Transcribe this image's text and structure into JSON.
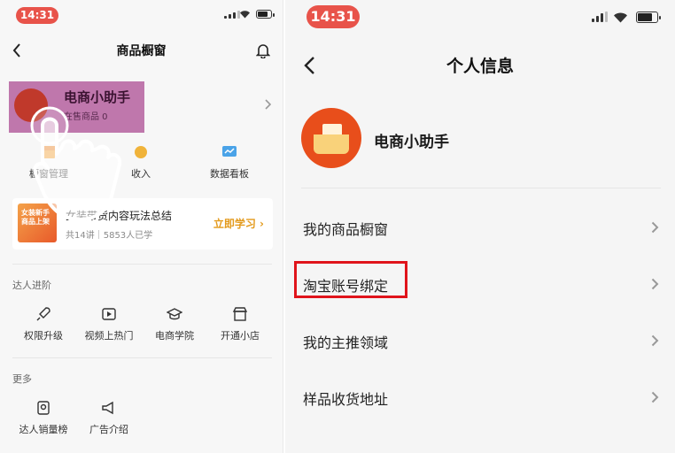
{
  "left": {
    "status": {
      "time": "14:31"
    },
    "nav": {
      "title": "商品橱窗"
    },
    "user": {
      "name": "电商小助手",
      "sub": "在售商品 0"
    },
    "tools": [
      {
        "label": "橱窗管理",
        "icon": "shop-icon"
      },
      {
        "label": "收入",
        "icon": "income-icon"
      },
      {
        "label": "数据看板",
        "icon": "chart-icon"
      }
    ],
    "course": {
      "thumb_text": "女装新手 商品上架",
      "title": "女装带货内容玩法总结",
      "meta": "共14讲｜5853人已学",
      "button": "立即学习 ›"
    },
    "section_advance": {
      "title": "达人进阶",
      "items": [
        {
          "label": "权限升级",
          "icon": "rocket-icon"
        },
        {
          "label": "视频上热门",
          "icon": "video-icon"
        },
        {
          "label": "电商学院",
          "icon": "graduation-cap-icon"
        },
        {
          "label": "开通小店",
          "icon": "store-icon"
        }
      ]
    },
    "section_more": {
      "title": "更多",
      "items": [
        {
          "label": "达人销量榜",
          "icon": "ranking-icon"
        },
        {
          "label": "广告介绍",
          "icon": "megaphone-icon"
        }
      ]
    }
  },
  "right": {
    "status": {
      "time": "14:31"
    },
    "nav": {
      "title": "个人信息"
    },
    "profile": {
      "name": "电商小助手"
    },
    "menu": [
      {
        "label": "我的商品橱窗"
      },
      {
        "label": "淘宝账号绑定",
        "highlighted": true
      },
      {
        "label": "我的主推领域"
      },
      {
        "label": "样品收货地址"
      }
    ]
  },
  "colors": {
    "highlight_box": "#e0141b",
    "time_pill": "#e8534a",
    "accent_orange": "#e39a1c"
  }
}
